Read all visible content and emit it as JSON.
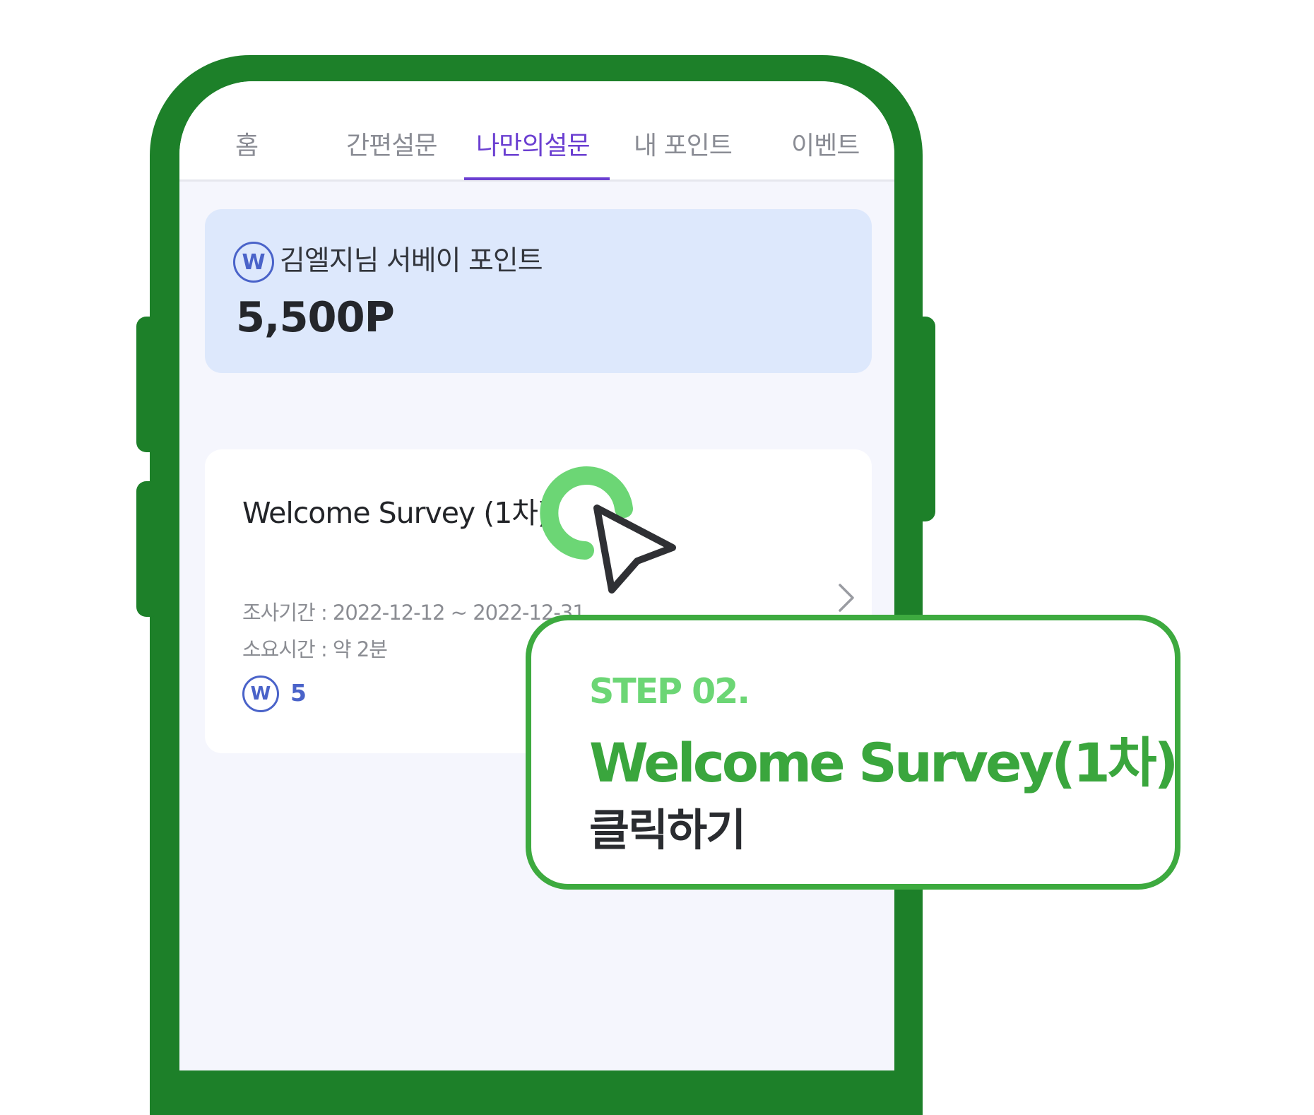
{
  "tabs": [
    {
      "label": "홈",
      "active": false
    },
    {
      "label": "간편설문",
      "active": false
    },
    {
      "label": "나만의설문",
      "active": true
    },
    {
      "label": "내 포인트",
      "active": false
    },
    {
      "label": "이벤트",
      "active": false
    }
  ],
  "points": {
    "badge": "W",
    "title": "김엘지님 서베이 포인트",
    "value": "5,500P"
  },
  "survey": {
    "title": "Welcome Survey (1차)",
    "period": "조사기간 : 2022-12-12 ~ 2022-12-31",
    "duration": "소요시간 : 약 2분",
    "reward_badge": "W",
    "reward": "5"
  },
  "callout": {
    "step": "STEP 02.",
    "title": "Welcome Survey(1차)",
    "action": "클릭하기"
  },
  "colors": {
    "phone_frame": "#1d8029",
    "accent_green": "#3daa3f",
    "step_green": "#6cd675",
    "tab_active": "#6b3fd1",
    "points_card_bg": "#dde8fc",
    "badge_blue": "#4a63c9"
  },
  "icons": [
    "w-point-icon",
    "chevron-right-icon",
    "click-ring-icon",
    "cursor-arrow-icon"
  ]
}
